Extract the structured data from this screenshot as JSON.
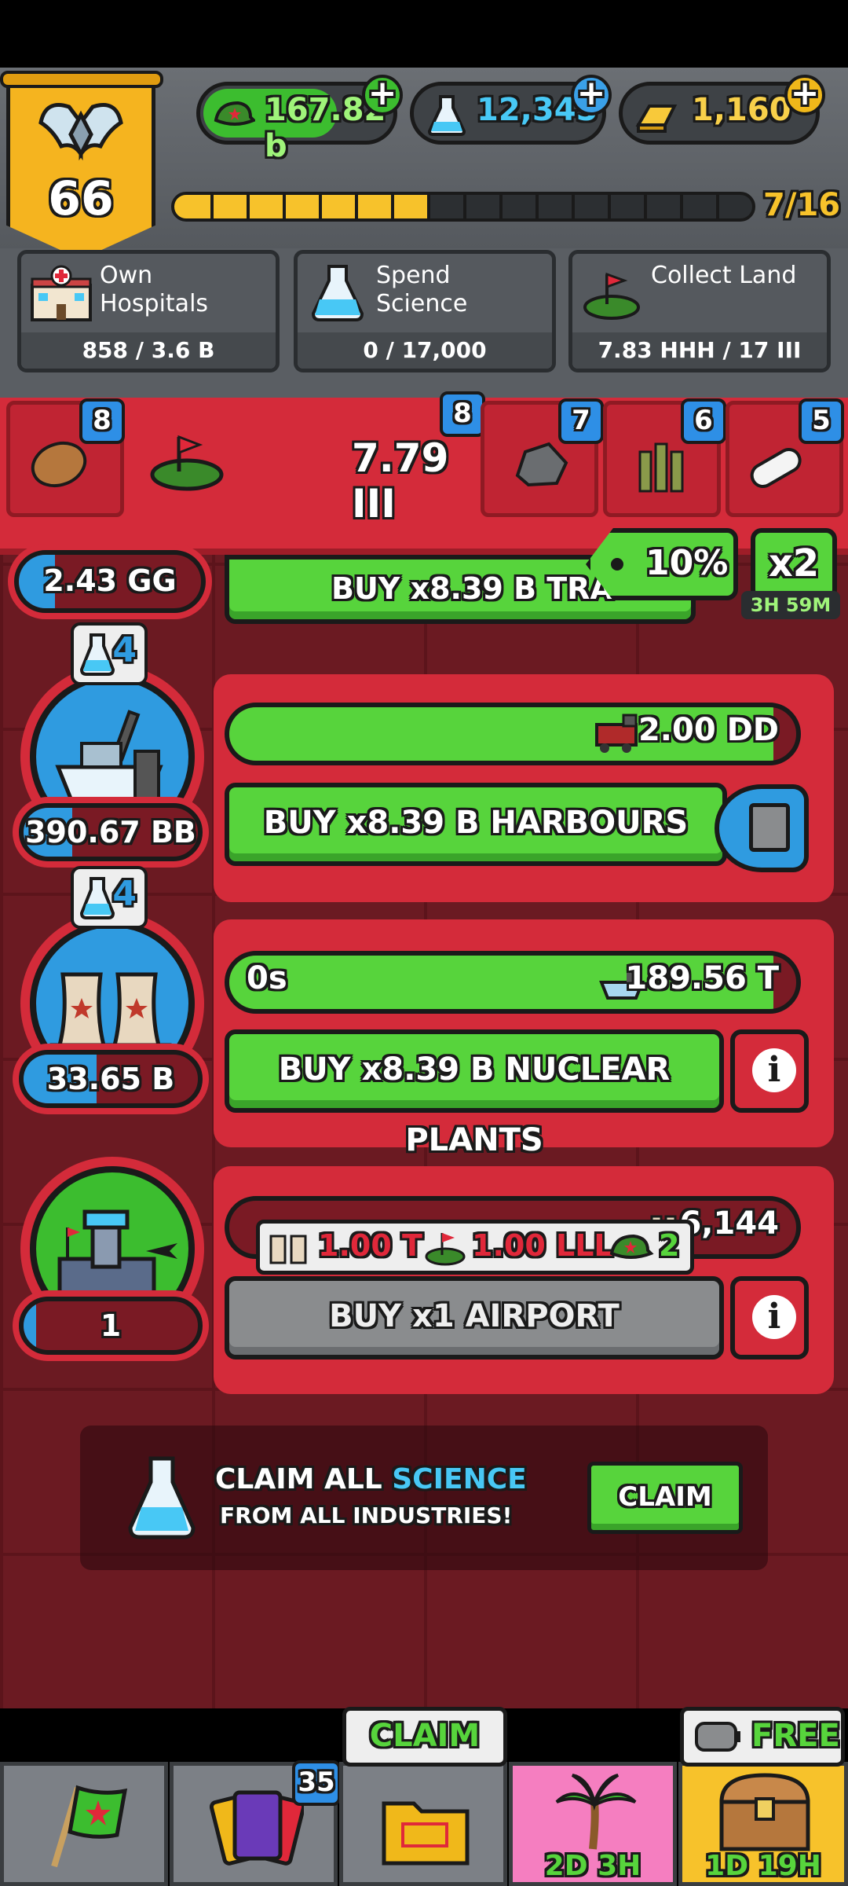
{
  "hud": {
    "level": "66",
    "cash": "167.82 b",
    "science": "12,345",
    "gold": "1,160",
    "xp_progress": "7/16",
    "xp_fraction": 0.4375
  },
  "missions": [
    {
      "label_line1": "Own",
      "label_line2": "Hospitals",
      "progress": "858 / 3.6 B"
    },
    {
      "label_line1": "Spend",
      "label_line2": "Science",
      "progress": "0 / 17,000"
    },
    {
      "label_line1": "Collect Land",
      "label_line2": "",
      "progress": "7.83 HHH / 17 III"
    }
  ],
  "tabs": {
    "land_value": "7.79 III",
    "badges": [
      "8",
      "8",
      "7",
      "6",
      "5"
    ]
  },
  "boost": {
    "partial_count": "2.43 GG",
    "partial_buy": "BUY x8.39 B TRA",
    "percent": "10%",
    "multiplier": "x2",
    "timer": "3H 59M"
  },
  "industries": [
    {
      "science": "4",
      "count": "390.67 BB",
      "count_fill": 0.28,
      "progress_right": "2.00 DD",
      "progress_fill": 0.96,
      "buy_label": "BUY x8.39 B HARBOURS"
    },
    {
      "science": "4",
      "count": "33.65 B",
      "count_fill": 0.42,
      "progress_left": "0s",
      "progress_right": "189.56 T",
      "progress_fill": 0.96,
      "buy_label": "BUY x8.39 B NUCLEAR PLANTS"
    },
    {
      "count": "1",
      "count_fill": 0.07,
      "progress_right": "6,144",
      "buy_label": "BUY x1 AIRPORT",
      "cost_plants": "1.00 T",
      "cost_land": "1.00 LLL",
      "cost_cash": "2"
    }
  ],
  "claim_banner": {
    "line1_prefix": "CLAIM ALL ",
    "line1_highlight": "SCIENCE",
    "line2": "FROM ALL INDUSTRIES!",
    "button": "CLAIM"
  },
  "nav": {
    "cards_badge": "35",
    "claim_label": "CLAIM",
    "free_label": "FREE",
    "island_timer": "2D 3H",
    "chest_timer": "1D 19H"
  },
  "colors": {
    "primary_red": "#d42b3a",
    "button_green": "#57d43c",
    "science_blue": "#48c8f5",
    "gold": "#f7c22b"
  }
}
